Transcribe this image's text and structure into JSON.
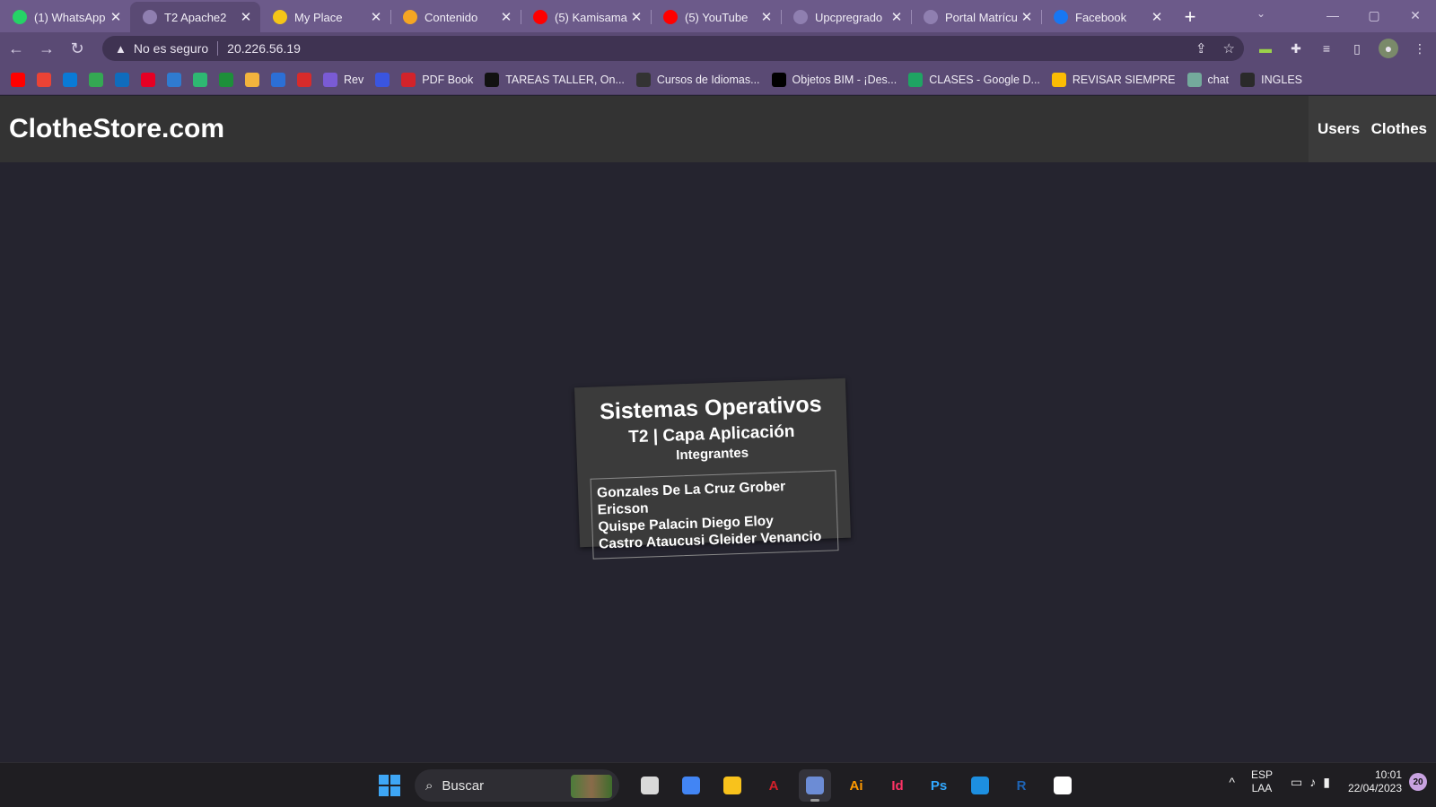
{
  "browser": {
    "tabs": [
      {
        "title": "(1) WhatsApp",
        "icon": "whatsapp-icon",
        "color": "#25d366"
      },
      {
        "title": "T2 Apache2",
        "icon": "globe-icon",
        "color": "#8f7fb0",
        "active": true
      },
      {
        "title": "My Place",
        "icon": "heart-icon",
        "color": "#f5c518"
      },
      {
        "title": "Contenido",
        "icon": "pencil-icon",
        "color": "#f5a623"
      },
      {
        "title": "(5) Kamisama",
        "icon": "youtube-icon",
        "color": "#ff0000"
      },
      {
        "title": "(5) YouTube",
        "icon": "youtube-icon",
        "color": "#ff0000"
      },
      {
        "title": "Upcpregrado",
        "icon": "globe-icon",
        "color": "#8f7fb0"
      },
      {
        "title": "Portal Matrícu",
        "icon": "globe-icon",
        "color": "#8f7fb0"
      },
      {
        "title": "Facebook",
        "icon": "facebook-icon",
        "color": "#1877f2"
      }
    ],
    "address": {
      "security_label": "No es seguro",
      "url": "20.226.56.19"
    },
    "bookmarks": [
      {
        "label": "",
        "icon": "youtube-icon",
        "color": "#ff0000"
      },
      {
        "label": "",
        "icon": "gmail-icon",
        "color": "#ea4335"
      },
      {
        "label": "",
        "icon": "onedrive-icon",
        "color": "#0a7ad6"
      },
      {
        "label": "",
        "icon": "maps-icon",
        "color": "#34a853"
      },
      {
        "label": "",
        "icon": "outlook-icon",
        "color": "#0f6cbd"
      },
      {
        "label": "",
        "icon": "pinterest-icon",
        "color": "#e60023"
      },
      {
        "label": "",
        "icon": "yammer-icon",
        "color": "#2f7bd0"
      },
      {
        "label": "",
        "icon": "vuetify-icon",
        "color": "#2eb872"
      },
      {
        "label": "",
        "icon": "game-icon",
        "color": "#1d8f3a"
      },
      {
        "label": "",
        "icon": "cat-icon",
        "color": "#f2b33d"
      },
      {
        "label": "",
        "icon": "box-icon",
        "color": "#2c6fd6"
      },
      {
        "label": "",
        "icon": "fish-icon",
        "color": "#d72b2b"
      },
      {
        "label": "Rev",
        "icon": "rev-icon",
        "color": "#7a5bd4"
      },
      {
        "label": "",
        "icon": "circle-icon",
        "color": "#3a55e0"
      },
      {
        "label": "PDF Book",
        "icon": "z-library-icon",
        "color": "#d2232a"
      },
      {
        "label": "TAREAS TALLER, On...",
        "icon": "miro-icon",
        "color": "#111111"
      },
      {
        "label": "Cursos de Idiomas...",
        "icon": "udemy-icon",
        "color": "#333333"
      },
      {
        "label": "Objetos BIM - ¡Des...",
        "icon": "bim-icon",
        "color": "#000000"
      },
      {
        "label": "CLASES - Google D...",
        "icon": "drive-icon",
        "color": "#1fa463"
      },
      {
        "label": "REVISAR SIEMPRE",
        "icon": "keep-icon",
        "color": "#fbbc04"
      },
      {
        "label": "chat",
        "icon": "chatgpt-icon",
        "color": "#74aa9c"
      },
      {
        "label": "INGLES",
        "icon": "ingles-icon",
        "color": "#2a2a2a"
      }
    ]
  },
  "site": {
    "brand": "ClotheStore.com",
    "nav": [
      "Users",
      "Clothes"
    ]
  },
  "card": {
    "title": "Sistemas Operativos",
    "subtitle": "T2 | Capa Aplicación",
    "section": "Integrantes",
    "members": [
      "Gonzales De La Cruz Grober Ericson",
      "Quispe Palacin Diego Eloy",
      "Castro Ataucusi Gleider Venancio"
    ]
  },
  "taskbar": {
    "search_label": "Buscar",
    "apps": [
      {
        "icon": "task-view-icon",
        "label": "",
        "color": "#d9d9d9"
      },
      {
        "icon": "chrome-icon",
        "label": "",
        "color": "#4285f4"
      },
      {
        "icon": "file-explorer-icon",
        "label": "",
        "color": "#f8c21c"
      },
      {
        "icon": "acrobat-icon",
        "label": "A",
        "color": "#d4202a"
      },
      {
        "icon": "snipping-tool-icon",
        "label": "",
        "color": "#6c8cd5",
        "active": true
      },
      {
        "icon": "illustrator-icon",
        "label": "Ai",
        "color": "#ff9a00"
      },
      {
        "icon": "indesign-icon",
        "label": "Id",
        "color": "#ff3366"
      },
      {
        "icon": "photoshop-icon",
        "label": "Ps",
        "color": "#31a8ff"
      },
      {
        "icon": "sketchup-icon",
        "label": "",
        "color": "#1d8fe0"
      },
      {
        "icon": "revit-icon",
        "label": "R",
        "color": "#1f64b4"
      },
      {
        "icon": "rhino-icon",
        "label": "",
        "color": "#ffffff"
      }
    ],
    "lang_top": "ESP",
    "lang_bottom": "LAA",
    "time": "10:01",
    "date": "22/04/2023",
    "notifications": "20"
  }
}
